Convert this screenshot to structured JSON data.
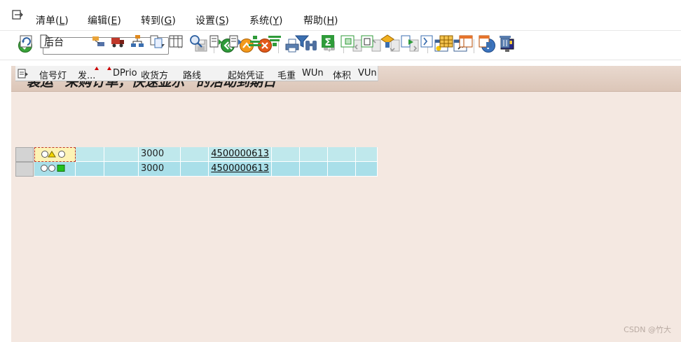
{
  "menu": {
    "items": [
      {
        "label": "清单(",
        "acc": "L",
        "suffix": ")"
      },
      {
        "label": "编辑(",
        "acc": "E",
        "suffix": ")"
      },
      {
        "label": "转到(",
        "acc": "G",
        "suffix": ")"
      },
      {
        "label": "设置(",
        "acc": "S",
        "suffix": ")"
      },
      {
        "label": "系统(",
        "acc": "Y",
        "suffix": ")"
      },
      {
        "label": "帮助(",
        "acc": "H",
        "suffix": ")"
      }
    ]
  },
  "toolbar": {
    "command_field": {
      "value": "",
      "placeholder": ""
    },
    "collapse_symbol": "«"
  },
  "title": "装运 \"采购订单，快速显示\" 的活动到期日",
  "alv_toolbar": {
    "background_label": "后台"
  },
  "grid": {
    "columns": [
      "信号灯",
      "发...",
      "DPrio",
      "收货方",
      "路线",
      "起始凭证",
      "毛重",
      "WUn",
      "体积",
      "VUn"
    ],
    "rows": [
      {
        "light": "yellow",
        "ship_point": "",
        "dprio": "",
        "ship_to": "3000",
        "route": "",
        "ref_doc": "4500000613",
        "gross_wt": "",
        "wun": "",
        "volume": "",
        "vun": ""
      },
      {
        "light": "green",
        "ship_point": "",
        "dprio": "",
        "ship_to": "3000",
        "route": "",
        "ref_doc": "4500000613",
        "gross_wt": "",
        "wun": "",
        "volume": "",
        "vun": ""
      }
    ]
  },
  "watermark": "CSDN @竹大",
  "colors": {
    "main_bg": "#f4e8e1",
    "row_bg": "#bfe8ec",
    "green_light": "#22c21c",
    "yellow_light": "#f2d500"
  }
}
